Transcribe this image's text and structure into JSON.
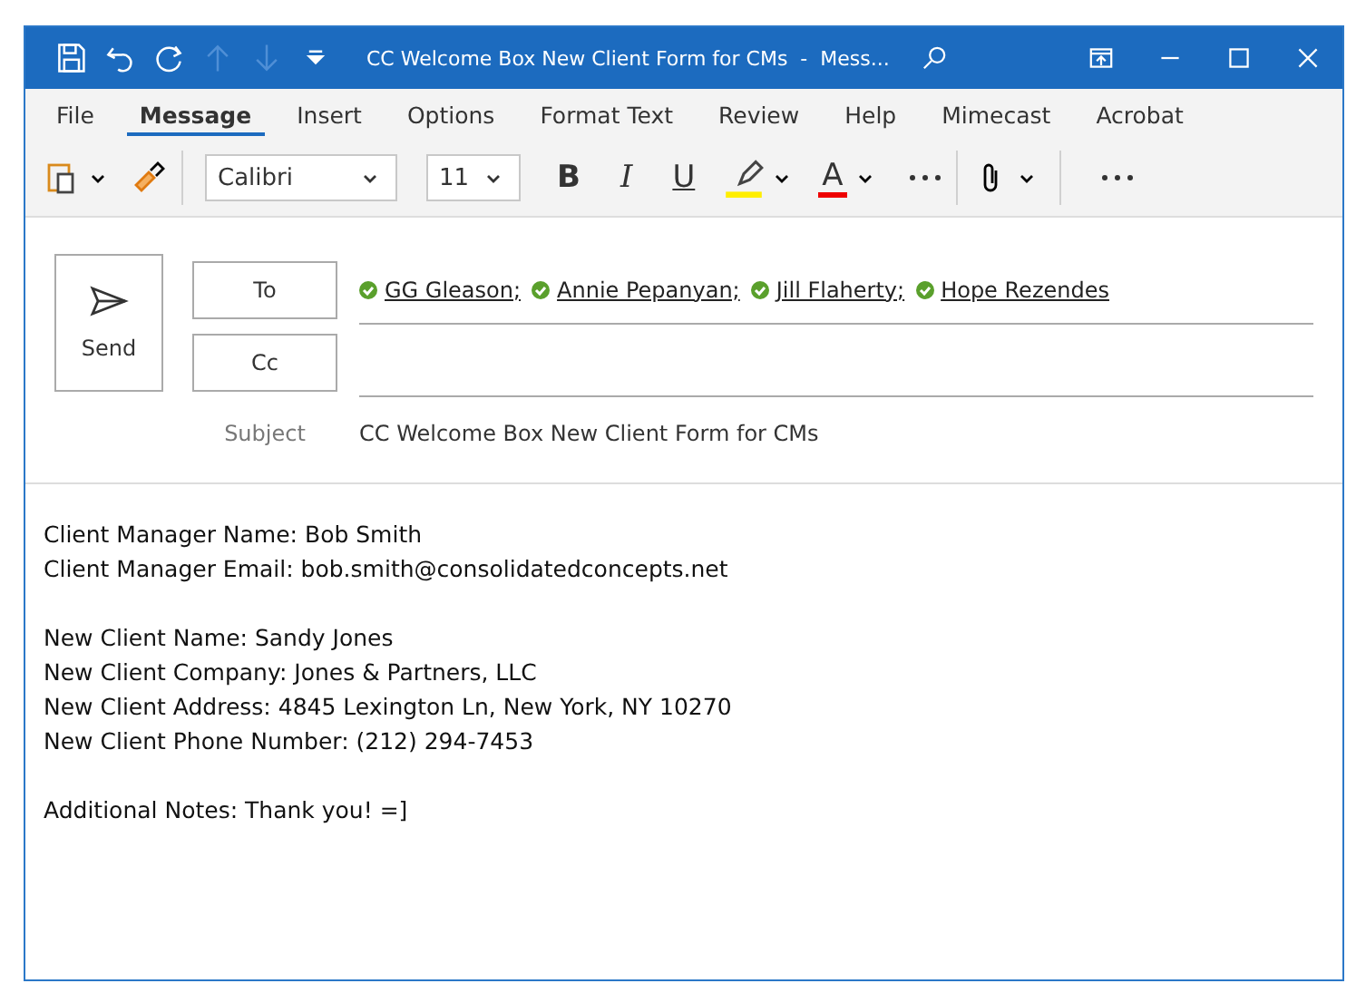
{
  "window": {
    "title": "CC Welcome Box New Client Form for CMs  -  Mess..."
  },
  "tabs": [
    {
      "label": "File",
      "selected": false
    },
    {
      "label": "Message",
      "selected": true
    },
    {
      "label": "Insert",
      "selected": false
    },
    {
      "label": "Options",
      "selected": false
    },
    {
      "label": "Format Text",
      "selected": false
    },
    {
      "label": "Review",
      "selected": false
    },
    {
      "label": "Help",
      "selected": false
    },
    {
      "label": "Mimecast",
      "selected": false
    },
    {
      "label": "Acrobat",
      "selected": false
    }
  ],
  "ribbon": {
    "font": "Calibri",
    "size": "11",
    "bold": "B",
    "italic": "I",
    "underline": "U",
    "font_color": "A"
  },
  "compose": {
    "send": "Send",
    "to_button": "To",
    "cc_button": "Cc",
    "subject_label": "Subject",
    "subject": "CC Welcome Box New Client Form for CMs",
    "to": [
      {
        "name": "GG Gleason",
        "separator": ";"
      },
      {
        "name": "Annie Pepanyan",
        "separator": ";"
      },
      {
        "name": "Jill Flaherty",
        "separator": ";"
      },
      {
        "name": "Hope Rezendes"
      }
    ]
  },
  "body": [
    [
      "Client Manager Name: Bob Smith",
      "Client Manager Email: bob.smith@consolidatedconcepts.net"
    ],
    [
      "New Client Name: Sandy Jones",
      "New Client Company: Jones & Partners, LLC",
      "New Client Address: 4845 Lexington Ln, New York, NY 10270",
      "New Client Phone Number: (212) 294-7453"
    ],
    [
      "Additional Notes: Thank you! =]"
    ]
  ]
}
